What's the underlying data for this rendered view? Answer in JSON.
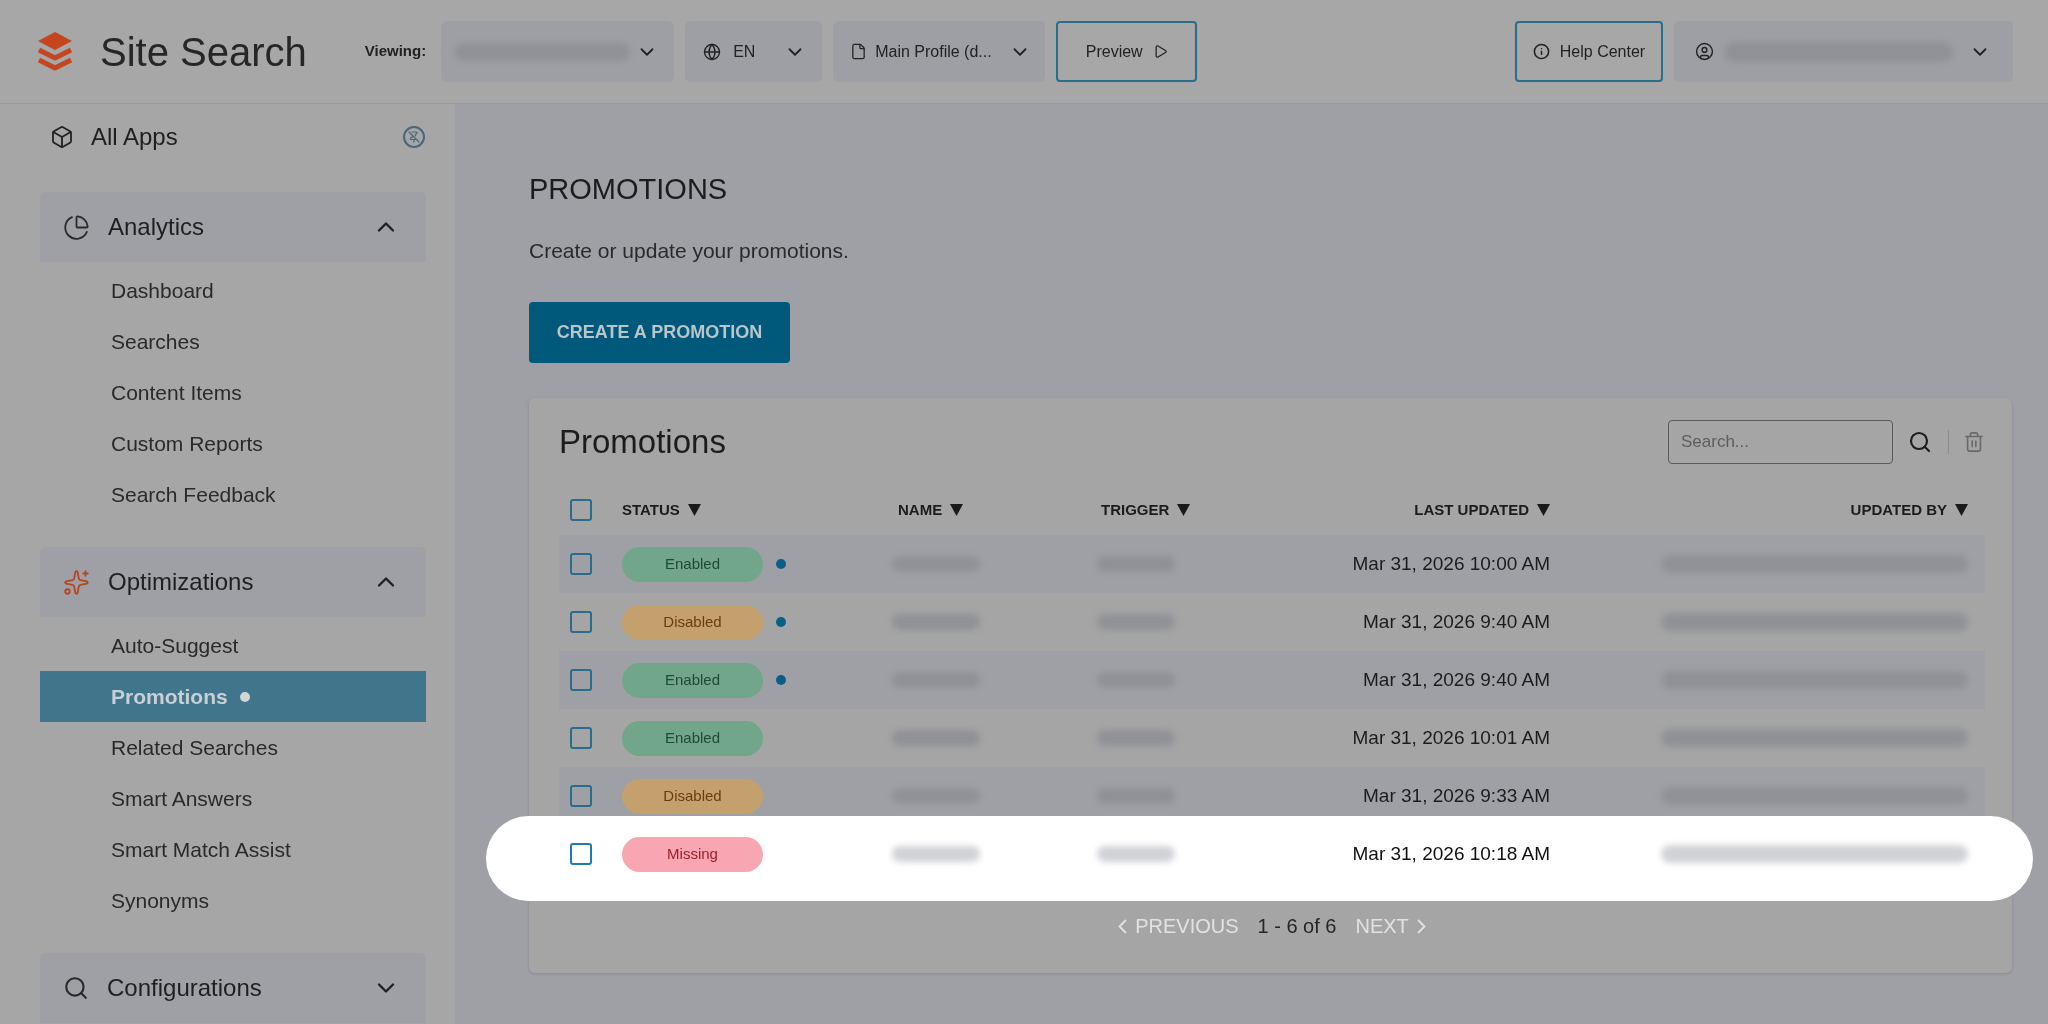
{
  "header": {
    "app_title": "Site Search",
    "viewing_label": "Viewing:",
    "language_dropdown": {
      "value": "EN"
    },
    "profile_dropdown": {
      "value": "Main Profile (d..."
    },
    "preview_button": "Preview",
    "help_button": "Help Center"
  },
  "sidebar": {
    "all_apps": "All Apps",
    "sections": [
      {
        "kind": "analytics",
        "title": "Analytics",
        "expanded": true,
        "items": [
          {
            "label": "Dashboard",
            "selected": false,
            "indicator": false
          },
          {
            "label": "Searches",
            "selected": false,
            "indicator": false
          },
          {
            "label": "Content Items",
            "selected": false,
            "indicator": false
          },
          {
            "label": "Custom Reports",
            "selected": false,
            "indicator": false
          },
          {
            "label": "Search Feedback",
            "selected": false,
            "indicator": false
          }
        ]
      },
      {
        "kind": "optimizations",
        "title": "Optimizations",
        "expanded": true,
        "items": [
          {
            "label": "Auto-Suggest",
            "selected": false,
            "indicator": false
          },
          {
            "label": "Promotions",
            "selected": true,
            "indicator": true
          },
          {
            "label": "Related Searches",
            "selected": false,
            "indicator": false
          },
          {
            "label": "Smart Answers",
            "selected": false,
            "indicator": false
          },
          {
            "label": "Smart Match Assist",
            "selected": false,
            "indicator": false
          },
          {
            "label": "Synonyms",
            "selected": false,
            "indicator": false
          }
        ]
      },
      {
        "kind": "configurations",
        "title": "Configurations",
        "expanded": false
      }
    ]
  },
  "page": {
    "title": "PROMOTIONS",
    "subtitle": "Create or update your promotions.",
    "create_button": "CREATE A PROMOTION"
  },
  "table": {
    "title": "Promotions",
    "search": {
      "placeholder": "Search..."
    },
    "select_all": {
      "checked": false
    },
    "columns": [
      {
        "label": "STATUS"
      },
      {
        "label": "NAME"
      },
      {
        "label": "TRIGGER"
      },
      {
        "label": "LAST UPDATED"
      },
      {
        "label": "UPDATED BY"
      }
    ],
    "rows": [
      {
        "checked": false,
        "status": {
          "label": "Enabled",
          "kind": "enabled"
        },
        "indicator": true,
        "last_updated": "Mar 31, 2026 10:00 AM",
        "highlighted": false
      },
      {
        "checked": false,
        "status": {
          "label": "Disabled",
          "kind": "disabled"
        },
        "indicator": true,
        "last_updated": "Mar 31, 2026 9:40 AM",
        "highlighted": false
      },
      {
        "checked": false,
        "status": {
          "label": "Enabled",
          "kind": "enabled"
        },
        "indicator": true,
        "last_updated": "Mar 31, 2026 9:40 AM",
        "highlighted": false
      },
      {
        "checked": false,
        "status": {
          "label": "Enabled",
          "kind": "enabled"
        },
        "indicator": false,
        "last_updated": "Mar 31, 2026 10:01 AM",
        "highlighted": false
      },
      {
        "checked": false,
        "status": {
          "label": "Disabled",
          "kind": "disabled"
        },
        "indicator": false,
        "last_updated": "Mar 31, 2026 9:33 AM",
        "highlighted": false
      },
      {
        "checked": false,
        "status": {
          "label": "Missing",
          "kind": "missing"
        },
        "indicator": false,
        "last_updated": "Mar 31, 2026 10:18 AM",
        "highlighted": true
      }
    ],
    "pagination": {
      "previous": {
        "label": "PREVIOUS",
        "disabled": true
      },
      "range": "1 - 6 of 6",
      "next": {
        "label": "NEXT",
        "disabled": true
      }
    }
  }
}
